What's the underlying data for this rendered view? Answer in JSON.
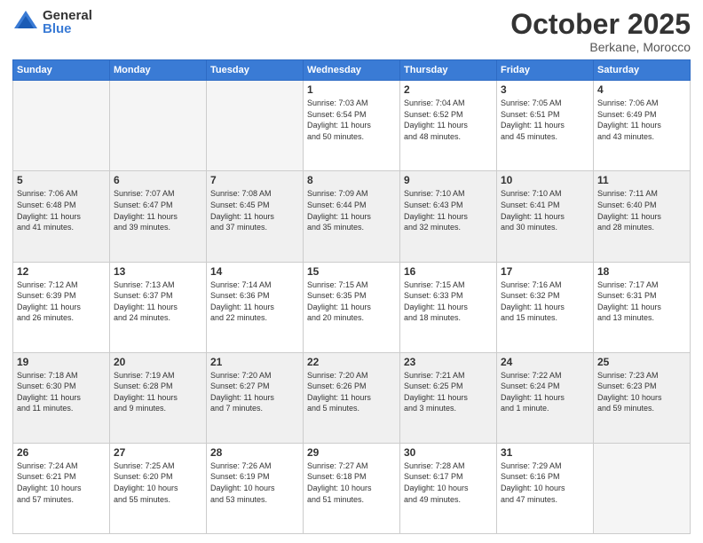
{
  "logo": {
    "general": "General",
    "blue": "Blue"
  },
  "header": {
    "month": "October 2025",
    "location": "Berkane, Morocco"
  },
  "weekdays": [
    "Sunday",
    "Monday",
    "Tuesday",
    "Wednesday",
    "Thursday",
    "Friday",
    "Saturday"
  ],
  "weeks": [
    [
      {
        "day": "",
        "info": ""
      },
      {
        "day": "",
        "info": ""
      },
      {
        "day": "",
        "info": ""
      },
      {
        "day": "1",
        "info": "Sunrise: 7:03 AM\nSunset: 6:54 PM\nDaylight: 11 hours\nand 50 minutes."
      },
      {
        "day": "2",
        "info": "Sunrise: 7:04 AM\nSunset: 6:52 PM\nDaylight: 11 hours\nand 48 minutes."
      },
      {
        "day": "3",
        "info": "Sunrise: 7:05 AM\nSunset: 6:51 PM\nDaylight: 11 hours\nand 45 minutes."
      },
      {
        "day": "4",
        "info": "Sunrise: 7:06 AM\nSunset: 6:49 PM\nDaylight: 11 hours\nand 43 minutes."
      }
    ],
    [
      {
        "day": "5",
        "info": "Sunrise: 7:06 AM\nSunset: 6:48 PM\nDaylight: 11 hours\nand 41 minutes."
      },
      {
        "day": "6",
        "info": "Sunrise: 7:07 AM\nSunset: 6:47 PM\nDaylight: 11 hours\nand 39 minutes."
      },
      {
        "day": "7",
        "info": "Sunrise: 7:08 AM\nSunset: 6:45 PM\nDaylight: 11 hours\nand 37 minutes."
      },
      {
        "day": "8",
        "info": "Sunrise: 7:09 AM\nSunset: 6:44 PM\nDaylight: 11 hours\nand 35 minutes."
      },
      {
        "day": "9",
        "info": "Sunrise: 7:10 AM\nSunset: 6:43 PM\nDaylight: 11 hours\nand 32 minutes."
      },
      {
        "day": "10",
        "info": "Sunrise: 7:10 AM\nSunset: 6:41 PM\nDaylight: 11 hours\nand 30 minutes."
      },
      {
        "day": "11",
        "info": "Sunrise: 7:11 AM\nSunset: 6:40 PM\nDaylight: 11 hours\nand 28 minutes."
      }
    ],
    [
      {
        "day": "12",
        "info": "Sunrise: 7:12 AM\nSunset: 6:39 PM\nDaylight: 11 hours\nand 26 minutes."
      },
      {
        "day": "13",
        "info": "Sunrise: 7:13 AM\nSunset: 6:37 PM\nDaylight: 11 hours\nand 24 minutes."
      },
      {
        "day": "14",
        "info": "Sunrise: 7:14 AM\nSunset: 6:36 PM\nDaylight: 11 hours\nand 22 minutes."
      },
      {
        "day": "15",
        "info": "Sunrise: 7:15 AM\nSunset: 6:35 PM\nDaylight: 11 hours\nand 20 minutes."
      },
      {
        "day": "16",
        "info": "Sunrise: 7:15 AM\nSunset: 6:33 PM\nDaylight: 11 hours\nand 18 minutes."
      },
      {
        "day": "17",
        "info": "Sunrise: 7:16 AM\nSunset: 6:32 PM\nDaylight: 11 hours\nand 15 minutes."
      },
      {
        "day": "18",
        "info": "Sunrise: 7:17 AM\nSunset: 6:31 PM\nDaylight: 11 hours\nand 13 minutes."
      }
    ],
    [
      {
        "day": "19",
        "info": "Sunrise: 7:18 AM\nSunset: 6:30 PM\nDaylight: 11 hours\nand 11 minutes."
      },
      {
        "day": "20",
        "info": "Sunrise: 7:19 AM\nSunset: 6:28 PM\nDaylight: 11 hours\nand 9 minutes."
      },
      {
        "day": "21",
        "info": "Sunrise: 7:20 AM\nSunset: 6:27 PM\nDaylight: 11 hours\nand 7 minutes."
      },
      {
        "day": "22",
        "info": "Sunrise: 7:20 AM\nSunset: 6:26 PM\nDaylight: 11 hours\nand 5 minutes."
      },
      {
        "day": "23",
        "info": "Sunrise: 7:21 AM\nSunset: 6:25 PM\nDaylight: 11 hours\nand 3 minutes."
      },
      {
        "day": "24",
        "info": "Sunrise: 7:22 AM\nSunset: 6:24 PM\nDaylight: 11 hours\nand 1 minute."
      },
      {
        "day": "25",
        "info": "Sunrise: 7:23 AM\nSunset: 6:23 PM\nDaylight: 10 hours\nand 59 minutes."
      }
    ],
    [
      {
        "day": "26",
        "info": "Sunrise: 7:24 AM\nSunset: 6:21 PM\nDaylight: 10 hours\nand 57 minutes."
      },
      {
        "day": "27",
        "info": "Sunrise: 7:25 AM\nSunset: 6:20 PM\nDaylight: 10 hours\nand 55 minutes."
      },
      {
        "day": "28",
        "info": "Sunrise: 7:26 AM\nSunset: 6:19 PM\nDaylight: 10 hours\nand 53 minutes."
      },
      {
        "day": "29",
        "info": "Sunrise: 7:27 AM\nSunset: 6:18 PM\nDaylight: 10 hours\nand 51 minutes."
      },
      {
        "day": "30",
        "info": "Sunrise: 7:28 AM\nSunset: 6:17 PM\nDaylight: 10 hours\nand 49 minutes."
      },
      {
        "day": "31",
        "info": "Sunrise: 7:29 AM\nSunset: 6:16 PM\nDaylight: 10 hours\nand 47 minutes."
      },
      {
        "day": "",
        "info": ""
      }
    ]
  ]
}
